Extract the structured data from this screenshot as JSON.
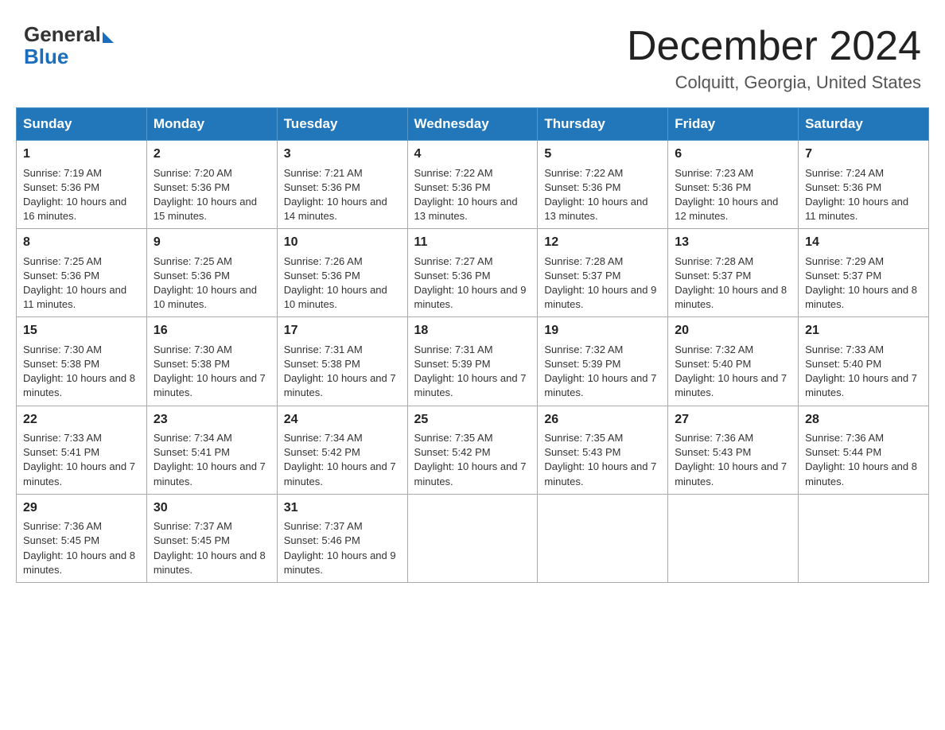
{
  "header": {
    "logo_general": "General",
    "logo_blue": "Blue",
    "title": "December 2024",
    "subtitle": "Colquitt, Georgia, United States"
  },
  "weekdays": [
    "Sunday",
    "Monday",
    "Tuesday",
    "Wednesday",
    "Thursday",
    "Friday",
    "Saturday"
  ],
  "weeks": [
    [
      {
        "day": "1",
        "sunrise": "7:19 AM",
        "sunset": "5:36 PM",
        "daylight": "10 hours and 16 minutes."
      },
      {
        "day": "2",
        "sunrise": "7:20 AM",
        "sunset": "5:36 PM",
        "daylight": "10 hours and 15 minutes."
      },
      {
        "day": "3",
        "sunrise": "7:21 AM",
        "sunset": "5:36 PM",
        "daylight": "10 hours and 14 minutes."
      },
      {
        "day": "4",
        "sunrise": "7:22 AM",
        "sunset": "5:36 PM",
        "daylight": "10 hours and 13 minutes."
      },
      {
        "day": "5",
        "sunrise": "7:22 AM",
        "sunset": "5:36 PM",
        "daylight": "10 hours and 13 minutes."
      },
      {
        "day": "6",
        "sunrise": "7:23 AM",
        "sunset": "5:36 PM",
        "daylight": "10 hours and 12 minutes."
      },
      {
        "day": "7",
        "sunrise": "7:24 AM",
        "sunset": "5:36 PM",
        "daylight": "10 hours and 11 minutes."
      }
    ],
    [
      {
        "day": "8",
        "sunrise": "7:25 AM",
        "sunset": "5:36 PM",
        "daylight": "10 hours and 11 minutes."
      },
      {
        "day": "9",
        "sunrise": "7:25 AM",
        "sunset": "5:36 PM",
        "daylight": "10 hours and 10 minutes."
      },
      {
        "day": "10",
        "sunrise": "7:26 AM",
        "sunset": "5:36 PM",
        "daylight": "10 hours and 10 minutes."
      },
      {
        "day": "11",
        "sunrise": "7:27 AM",
        "sunset": "5:36 PM",
        "daylight": "10 hours and 9 minutes."
      },
      {
        "day": "12",
        "sunrise": "7:28 AM",
        "sunset": "5:37 PM",
        "daylight": "10 hours and 9 minutes."
      },
      {
        "day": "13",
        "sunrise": "7:28 AM",
        "sunset": "5:37 PM",
        "daylight": "10 hours and 8 minutes."
      },
      {
        "day": "14",
        "sunrise": "7:29 AM",
        "sunset": "5:37 PM",
        "daylight": "10 hours and 8 minutes."
      }
    ],
    [
      {
        "day": "15",
        "sunrise": "7:30 AM",
        "sunset": "5:38 PM",
        "daylight": "10 hours and 8 minutes."
      },
      {
        "day": "16",
        "sunrise": "7:30 AM",
        "sunset": "5:38 PM",
        "daylight": "10 hours and 7 minutes."
      },
      {
        "day": "17",
        "sunrise": "7:31 AM",
        "sunset": "5:38 PM",
        "daylight": "10 hours and 7 minutes."
      },
      {
        "day": "18",
        "sunrise": "7:31 AM",
        "sunset": "5:39 PM",
        "daylight": "10 hours and 7 minutes."
      },
      {
        "day": "19",
        "sunrise": "7:32 AM",
        "sunset": "5:39 PM",
        "daylight": "10 hours and 7 minutes."
      },
      {
        "day": "20",
        "sunrise": "7:32 AM",
        "sunset": "5:40 PM",
        "daylight": "10 hours and 7 minutes."
      },
      {
        "day": "21",
        "sunrise": "7:33 AM",
        "sunset": "5:40 PM",
        "daylight": "10 hours and 7 minutes."
      }
    ],
    [
      {
        "day": "22",
        "sunrise": "7:33 AM",
        "sunset": "5:41 PM",
        "daylight": "10 hours and 7 minutes."
      },
      {
        "day": "23",
        "sunrise": "7:34 AM",
        "sunset": "5:41 PM",
        "daylight": "10 hours and 7 minutes."
      },
      {
        "day": "24",
        "sunrise": "7:34 AM",
        "sunset": "5:42 PM",
        "daylight": "10 hours and 7 minutes."
      },
      {
        "day": "25",
        "sunrise": "7:35 AM",
        "sunset": "5:42 PM",
        "daylight": "10 hours and 7 minutes."
      },
      {
        "day": "26",
        "sunrise": "7:35 AM",
        "sunset": "5:43 PM",
        "daylight": "10 hours and 7 minutes."
      },
      {
        "day": "27",
        "sunrise": "7:36 AM",
        "sunset": "5:43 PM",
        "daylight": "10 hours and 7 minutes."
      },
      {
        "day": "28",
        "sunrise": "7:36 AM",
        "sunset": "5:44 PM",
        "daylight": "10 hours and 8 minutes."
      }
    ],
    [
      {
        "day": "29",
        "sunrise": "7:36 AM",
        "sunset": "5:45 PM",
        "daylight": "10 hours and 8 minutes."
      },
      {
        "day": "30",
        "sunrise": "7:37 AM",
        "sunset": "5:45 PM",
        "daylight": "10 hours and 8 minutes."
      },
      {
        "day": "31",
        "sunrise": "7:37 AM",
        "sunset": "5:46 PM",
        "daylight": "10 hours and 9 minutes."
      },
      null,
      null,
      null,
      null
    ]
  ],
  "labels": {
    "sunrise": "Sunrise:",
    "sunset": "Sunset:",
    "daylight": "Daylight:"
  }
}
